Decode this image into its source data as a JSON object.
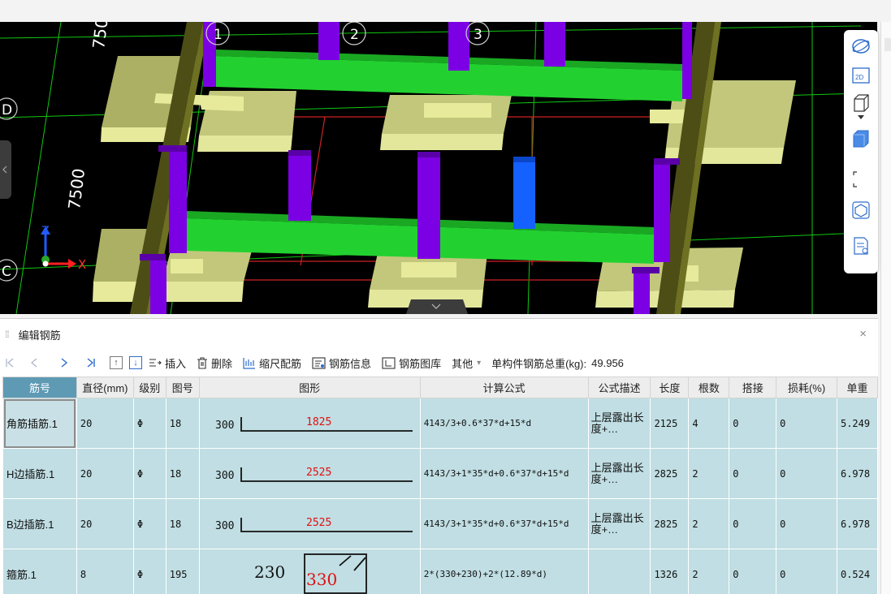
{
  "viewport": {
    "axis_labels": {
      "row_d": "D",
      "row_c": "C",
      "col_1": "1",
      "col_2": "2",
      "col_3": "3"
    },
    "dimensions": {
      "top": "750",
      "middle": "7500"
    },
    "gizmo": {
      "x": "X",
      "z": "Z"
    },
    "toolbar_icons": [
      "orbit-icon",
      "2d-view-icon",
      "3d-box-icon",
      "dropdown-arrow-icon",
      "color-box-icon",
      "selection-frame-icon",
      "dynamic-observe-icon",
      "display-settings-icon"
    ],
    "toolbar_2d_label": "2D",
    "colors": {
      "slab": "#c9cd86",
      "column": "#7c00e4",
      "beam": "#22d130",
      "post": "#4d4e16",
      "selected_column": "#1461ff",
      "grid_line": "#10c810",
      "rebar_line": "#cc2222"
    }
  },
  "panel": {
    "title": "编辑钢筋",
    "close": "×",
    "toolbar": {
      "insert": "插入",
      "delete": "删除",
      "scale": "缩尺配筋",
      "rebar_info": "钢筋信息",
      "rebar_library": "钢筋图库",
      "other": "其他",
      "other_arrow": "▾",
      "total_weight_label": "单构件钢筋总重(kg):",
      "total_weight_value": "49.956"
    }
  },
  "table": {
    "headers": [
      "筋号",
      "直径(mm)",
      "级别",
      "图号",
      "图形",
      "计算公式",
      "公式描述",
      "长度",
      "根数",
      "搭接",
      "损耗(%)",
      "单重"
    ],
    "rows": [
      {
        "name": "角筋插筋.1",
        "diameter": "20",
        "grade": "Φ",
        "fig_no": "18",
        "shape_left": "300",
        "shape_value": "1825",
        "formula": "4143/3+0.6*37*d+15*d",
        "desc": "上层露出长度+…",
        "length": "2125",
        "count": "4",
        "lap": "0",
        "loss": "0",
        "unit_weight": "5.249"
      },
      {
        "name": "H边插筋.1",
        "diameter": "20",
        "grade": "Φ",
        "fig_no": "18",
        "shape_left": "300",
        "shape_value": "2525",
        "formula": "4143/3+1*35*d+0.6*37*d+15*d",
        "desc": "上层露出长度+…",
        "length": "2825",
        "count": "2",
        "lap": "0",
        "loss": "0",
        "unit_weight": "6.978"
      },
      {
        "name": "B边插筋.1",
        "diameter": "20",
        "grade": "Φ",
        "fig_no": "18",
        "shape_left": "300",
        "shape_value": "2525",
        "formula": "4143/3+1*35*d+0.6*37*d+15*d",
        "desc": "上层露出长度+…",
        "length": "2825",
        "count": "2",
        "lap": "0",
        "loss": "0",
        "unit_weight": "6.978"
      },
      {
        "name": "箍筋.1",
        "diameter": "8",
        "grade": "Φ",
        "fig_no": "195",
        "shape_left": "230",
        "shape_value": "330",
        "formula": "2*(330+230)+2*(12.89*d)",
        "desc": "",
        "length": "1326",
        "count": "2",
        "lap": "0",
        "loss": "0",
        "unit_weight": "0.524"
      }
    ]
  }
}
